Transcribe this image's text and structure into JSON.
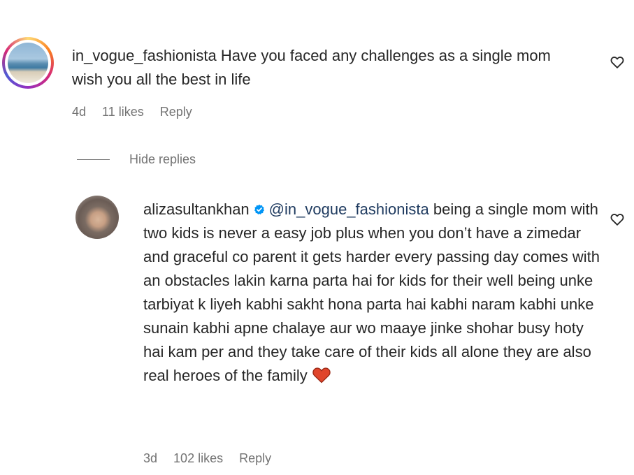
{
  "comment": {
    "username": "in_vogue_fashionista",
    "text": "Have you faced any challenges as a single mom wish you all the best in life",
    "age": "4d",
    "likes": "11 likes",
    "reply_label": "Reply",
    "avatar_icon": "beach-avatar",
    "like_icon": "heart-outline-icon"
  },
  "replies_toggle": {
    "label": "Hide replies"
  },
  "reply": {
    "username": "alizasultankhan",
    "verified_icon": "verified-badge-icon",
    "verified_color": "#0095f6",
    "mention": "@in_vogue_fashionista",
    "text": "being a single mom with two kids is never a easy job plus when you don’t have a zimedar and graceful co parent it gets harder every passing day comes with an obstacles lakin karna parta hai for kids for their well being unke tarbiyat k liyeh kabhi sakht hona parta hai kabhi naram kabhi unke sunain kabhi apne chalaye aur wo maaye jinke shohar busy hoty hai kam per and they take care of their kids all alone they are also real heroes of the family",
    "emoji": "red-heart-emoji",
    "emoji_color": "#e0452b",
    "age": "3d",
    "likes": "102 likes",
    "reply_label": "Reply",
    "avatar_icon": "profile-photo-avatar",
    "like_icon": "heart-outline-icon"
  }
}
